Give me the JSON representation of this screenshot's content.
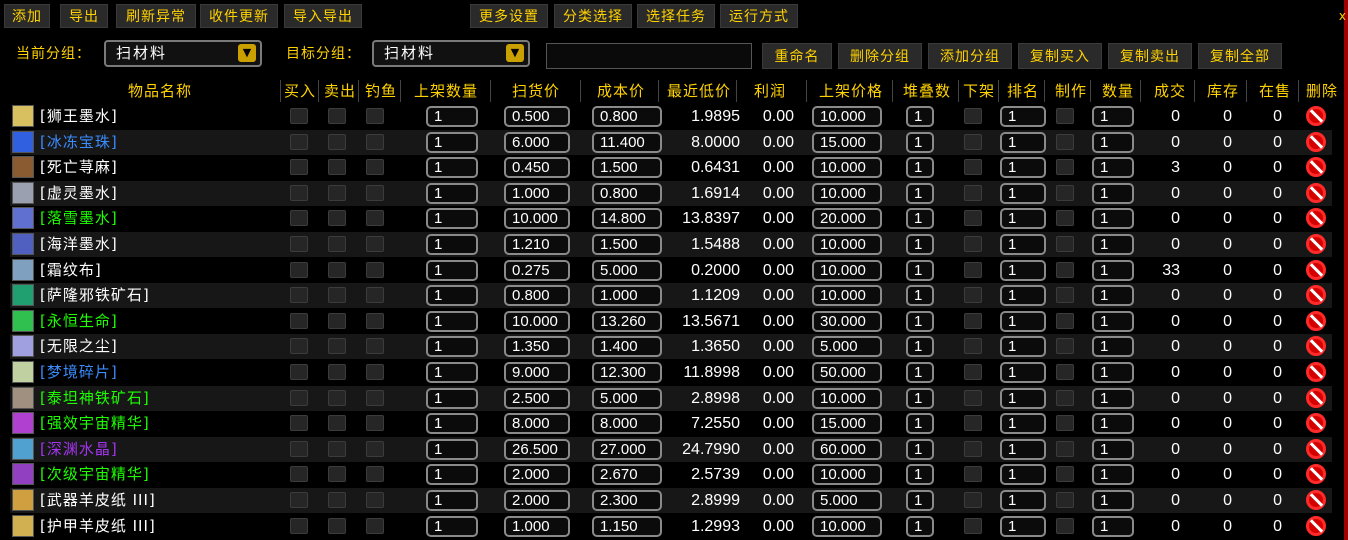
{
  "toolbar": {
    "buttons": [
      "添加",
      "导出",
      "刷新异常",
      "收件更新",
      "导入导出",
      "更多设置",
      "分类选择",
      "选择任务",
      "运行方式"
    ],
    "close": "x"
  },
  "groupbar": {
    "current_label": "当前分组：",
    "current_value": "扫材料",
    "target_label": "目标分组：",
    "target_value": "扫材料",
    "name_value": "",
    "buttons": [
      "重命名",
      "删除分组",
      "添加分组",
      "复制买入",
      "复制卖出",
      "复制全部"
    ]
  },
  "columns": [
    "物品名称",
    "买入",
    "卖出",
    "钓鱼",
    "上架数量",
    "扫货价",
    "成本价",
    "最近低价",
    "利润",
    "上架价格",
    "堆叠数",
    "下架",
    "排名",
    "制作",
    "数量",
    "成交",
    "库存",
    "在售",
    "删除"
  ],
  "colors": {
    "white": "#ffffff",
    "blue": "#3a8cff",
    "green": "#1eff00",
    "purple": "#a335ee",
    "gold": "#ffd200"
  },
  "items": [
    {
      "name": "[狮王墨水]",
      "color": "#ffffff",
      "icon": "#d8c060",
      "qty": "1",
      "buy": "0.500",
      "cost": "0.800",
      "low": "1.9895",
      "profit": "0.00",
      "list": "10.000",
      "stack": "1",
      "rank": "1",
      "count": "1",
      "sold": "0",
      "stock": "0",
      "onsale": "0"
    },
    {
      "name": "[冰冻宝珠]",
      "color": "#3a8cff",
      "icon": "#3060e0",
      "qty": "1",
      "buy": "6.000",
      "cost": "11.400",
      "low": "8.0000",
      "profit": "0.00",
      "list": "15.000",
      "stack": "1",
      "rank": "1",
      "count": "1",
      "sold": "0",
      "stock": "0",
      "onsale": "0"
    },
    {
      "name": "[死亡荨麻]",
      "color": "#ffffff",
      "icon": "#8a5a30",
      "qty": "1",
      "buy": "0.450",
      "cost": "1.500",
      "low": "0.6431",
      "profit": "0.00",
      "list": "10.000",
      "stack": "1",
      "rank": "1",
      "count": "1",
      "sold": "3",
      "stock": "0",
      "onsale": "0"
    },
    {
      "name": "[虚灵墨水]",
      "color": "#ffffff",
      "icon": "#9aa0b0",
      "qty": "1",
      "buy": "1.000",
      "cost": "0.800",
      "low": "1.6914",
      "profit": "0.00",
      "list": "10.000",
      "stack": "1",
      "rank": "1",
      "count": "1",
      "sold": "0",
      "stock": "0",
      "onsale": "0"
    },
    {
      "name": "[落雪墨水]",
      "color": "#1eff00",
      "icon": "#6070d0",
      "qty": "1",
      "buy": "10.000",
      "cost": "14.800",
      "low": "13.8397",
      "profit": "0.00",
      "list": "20.000",
      "stack": "1",
      "rank": "1",
      "count": "1",
      "sold": "0",
      "stock": "0",
      "onsale": "0"
    },
    {
      "name": "[海洋墨水]",
      "color": "#ffffff",
      "icon": "#5060c0",
      "qty": "1",
      "buy": "1.210",
      "cost": "1.500",
      "low": "1.5488",
      "profit": "0.00",
      "list": "10.000",
      "stack": "1",
      "rank": "1",
      "count": "1",
      "sold": "0",
      "stock": "0",
      "onsale": "0"
    },
    {
      "name": "[霜纹布]",
      "color": "#ffffff",
      "icon": "#80a0c0",
      "qty": "1",
      "buy": "0.275",
      "cost": "5.000",
      "low": "0.2000",
      "profit": "0.00",
      "list": "10.000",
      "stack": "1",
      "rank": "1",
      "count": "1",
      "sold": "33",
      "stock": "0",
      "onsale": "0"
    },
    {
      "name": "[萨隆邪铁矿石]",
      "color": "#ffffff",
      "icon": "#20a070",
      "qty": "1",
      "buy": "0.800",
      "cost": "1.000",
      "low": "1.1209",
      "profit": "0.00",
      "list": "10.000",
      "stack": "1",
      "rank": "1",
      "count": "1",
      "sold": "0",
      "stock": "0",
      "onsale": "0"
    },
    {
      "name": "[永恒生命]",
      "color": "#1eff00",
      "icon": "#30c050",
      "qty": "1",
      "buy": "10.000",
      "cost": "13.260",
      "low": "13.5671",
      "profit": "0.00",
      "list": "30.000",
      "stack": "1",
      "rank": "1",
      "count": "1",
      "sold": "0",
      "stock": "0",
      "onsale": "0"
    },
    {
      "name": "[无限之尘]",
      "color": "#ffffff",
      "icon": "#a0a0e0",
      "qty": "1",
      "buy": "1.350",
      "cost": "1.400",
      "low": "1.3650",
      "profit": "0.00",
      "list": "5.000",
      "stack": "1",
      "rank": "1",
      "count": "1",
      "sold": "0",
      "stock": "0",
      "onsale": "0"
    },
    {
      "name": "[梦境碎片]",
      "color": "#3a8cff",
      "icon": "#c0d0a0",
      "qty": "1",
      "buy": "9.000",
      "cost": "12.300",
      "low": "11.8998",
      "profit": "0.00",
      "list": "50.000",
      "stack": "1",
      "rank": "1",
      "count": "1",
      "sold": "0",
      "stock": "0",
      "onsale": "0"
    },
    {
      "name": "[泰坦神铁矿石]",
      "color": "#1eff00",
      "icon": "#a09080",
      "qty": "1",
      "buy": "2.500",
      "cost": "5.000",
      "low": "2.8998",
      "profit": "0.00",
      "list": "10.000",
      "stack": "1",
      "rank": "1",
      "count": "1",
      "sold": "0",
      "stock": "0",
      "onsale": "0"
    },
    {
      "name": "[强效宇宙精华]",
      "color": "#1eff00",
      "icon": "#b040d0",
      "qty": "1",
      "buy": "8.000",
      "cost": "8.000",
      "low": "7.2550",
      "profit": "0.00",
      "list": "15.000",
      "stack": "1",
      "rank": "1",
      "count": "1",
      "sold": "0",
      "stock": "0",
      "onsale": "0"
    },
    {
      "name": "[深渊水晶]",
      "color": "#a335ee",
      "icon": "#50a0d0",
      "qty": "1",
      "buy": "26.500",
      "cost": "27.000",
      "low": "24.7990",
      "profit": "0.00",
      "list": "60.000",
      "stack": "1",
      "rank": "1",
      "count": "1",
      "sold": "0",
      "stock": "0",
      "onsale": "0"
    },
    {
      "name": "[次级宇宙精华]",
      "color": "#1eff00",
      "icon": "#9040c0",
      "qty": "1",
      "buy": "2.000",
      "cost": "2.670",
      "low": "2.5739",
      "profit": "0.00",
      "list": "10.000",
      "stack": "1",
      "rank": "1",
      "count": "1",
      "sold": "0",
      "stock": "0",
      "onsale": "0"
    },
    {
      "name": "[武器羊皮纸 III]",
      "color": "#ffffff",
      "icon": "#d0a040",
      "qty": "1",
      "buy": "2.000",
      "cost": "2.300",
      "low": "2.8999",
      "profit": "0.00",
      "list": "5.000",
      "stack": "1",
      "rank": "1",
      "count": "1",
      "sold": "0",
      "stock": "0",
      "onsale": "0"
    },
    {
      "name": "[护甲羊皮纸 III]",
      "color": "#ffffff",
      "icon": "#d0b050",
      "qty": "1",
      "buy": "1.000",
      "cost": "1.150",
      "low": "1.2993",
      "profit": "0.00",
      "list": "10.000",
      "stack": "1",
      "rank": "1",
      "count": "1",
      "sold": "0",
      "stock": "0",
      "onsale": "0"
    }
  ]
}
